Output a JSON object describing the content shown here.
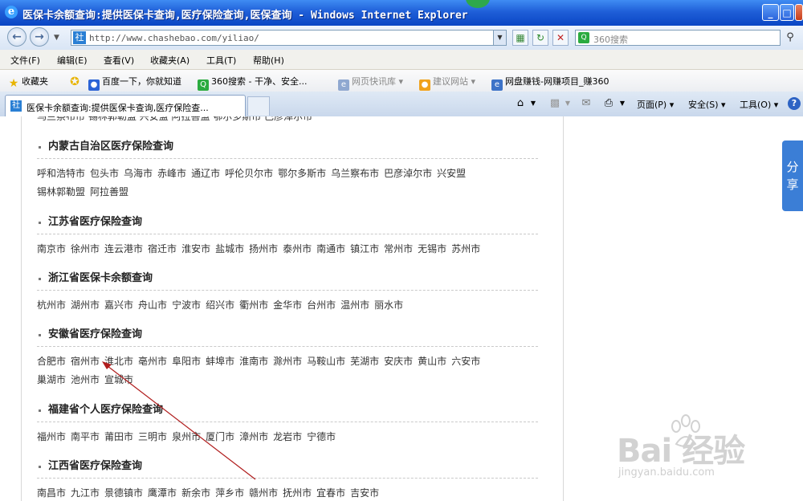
{
  "window": {
    "title": "医保卡余额查询:提供医保卡查询,医疗保险查询,医保查询 - Windows Internet Explorer",
    "buttons": [
      "_",
      "□",
      "✕"
    ]
  },
  "address": {
    "url": "http://www.chashebao.com/yiliao/",
    "site_icon": "社",
    "search_placeholder": "360搜索"
  },
  "menu": [
    "文件(F)",
    "编辑(E)",
    "查看(V)",
    "收藏夹(A)",
    "工具(T)",
    "帮助(H)"
  ],
  "favorites": {
    "label": "收藏夹",
    "items": [
      "百度一下，你就知道",
      "360搜索 - 干净、安全...",
      "网页快讯库 ▾",
      "建议网站 ▾",
      "网盘赚钱-网赚项目_赚360"
    ]
  },
  "tab": {
    "label": "医保卡余额查询:提供医保卡查询,医疗保险查..."
  },
  "commandbar": {
    "page": "页面(P) ▾",
    "safety": "安全(S) ▾",
    "tools": "工具(O) ▾"
  },
  "content": {
    "cut_row": "乌兰察布市  锡林郭勒盟  兴安盟  阿拉善盟  鄂尔多斯市  巴彦淖尔市",
    "sections": [
      {
        "title": "内蒙古自治区医疗保险查询",
        "cities": [
          "呼和浩特市",
          "包头市",
          "乌海市",
          "赤峰市",
          "通辽市",
          "呼伦贝尔市",
          "鄂尔多斯市",
          "乌兰察布市",
          "巴彦淖尔市",
          "兴安盟",
          "锡林郭勒盟",
          "阿拉善盟"
        ]
      },
      {
        "title": "江苏省医疗保险查询",
        "cities": [
          "南京市",
          "徐州市",
          "连云港市",
          "宿迁市",
          "淮安市",
          "盐城市",
          "扬州市",
          "泰州市",
          "南通市",
          "镇江市",
          "常州市",
          "无锡市",
          "苏州市"
        ]
      },
      {
        "title": "浙江省医保卡余额查询",
        "cities": [
          "杭州市",
          "湖州市",
          "嘉兴市",
          "舟山市",
          "宁波市",
          "绍兴市",
          "衢州市",
          "金华市",
          "台州市",
          "温州市",
          "丽水市"
        ]
      },
      {
        "title": "安徽省医疗保险查询",
        "cities": [
          "合肥市",
          "宿州市",
          "淮北市",
          "亳州市",
          "阜阳市",
          "蚌埠市",
          "淮南市",
          "滁州市",
          "马鞍山市",
          "芜湖市",
          "安庆市",
          "黄山市",
          "六安市",
          "巢湖市",
          "池州市",
          "宣城市"
        ]
      },
      {
        "title": "福建省个人医疗保险查询",
        "cities": [
          "福州市",
          "南平市",
          "莆田市",
          "三明市",
          "泉州市",
          "厦门市",
          "漳州市",
          "龙岩市",
          "宁德市"
        ]
      },
      {
        "title": "江西省医疗保险查询",
        "cities": [
          "南昌市",
          "九江市",
          "景德镇市",
          "鹰潭市",
          "新余市",
          "萍乡市",
          "赣州市",
          "抚州市",
          "宜春市",
          "吉安市"
        ]
      }
    ]
  },
  "share": "分享",
  "watermark": {
    "brand": "Bai 经验",
    "url": "jingyan.baidu.com"
  },
  "colors": {
    "titlebar": "#1f5fd8",
    "share": "#3b7ed6",
    "arrow": "#b01c1c"
  }
}
